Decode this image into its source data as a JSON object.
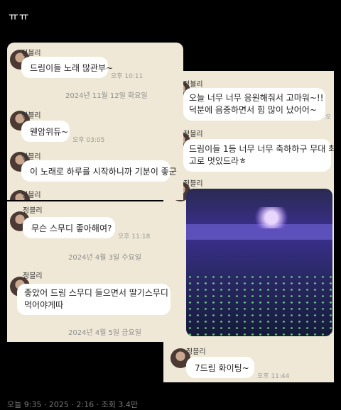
{
  "top_text": "ㅠㅠ",
  "left_top": {
    "m1": {
      "name": "정블리",
      "text": "드림이들 노래 많관부~",
      "time": "오후 10:11"
    },
    "date1": "2024년 11월 12일 화요일",
    "m2": {
      "name": "정블리",
      "text": "웬암위듀~",
      "time": "오후 03:05"
    },
    "m3": {
      "name": "정블리",
      "text": "이 노래로 하루를 시작하니까 기분이 좋군"
    },
    "m4": {
      "name": "정블리"
    }
  },
  "left_bottom": {
    "m1": {
      "name": "정블리",
      "text": "무슨 스무디 좋아해여?",
      "time": "오후 11:18"
    },
    "date1": "2024년 4월 3일 수요일",
    "m2": {
      "name": "정블리",
      "line1": "좋았어 드림 스무디 들으면서 딸기스무디",
      "line2": "먹어야게따"
    },
    "date2": "2024년 4월 5일 금요일"
  },
  "right": {
    "m1": {
      "name": "정블리",
      "line1": "오늘 너무 너무 응원해줘서 고마워~!!",
      "line2": "덕분에 음중하면서 힘 많이 났어어~",
      "time_partial": "오"
    },
    "m2": {
      "name": "정블리",
      "line1": "드림이들 1등 너무 너무 축하하구 무대 최",
      "line2": "고로 멋있드라ㅎ"
    },
    "m3": {
      "name": "정블리"
    },
    "m4": {
      "name": "정블리",
      "text": "7드림 화이팅~",
      "time": "오후 11:44"
    }
  },
  "bottom_text": "오늘 9:35 · 2025 · 2:16 · 조회 3.4만"
}
